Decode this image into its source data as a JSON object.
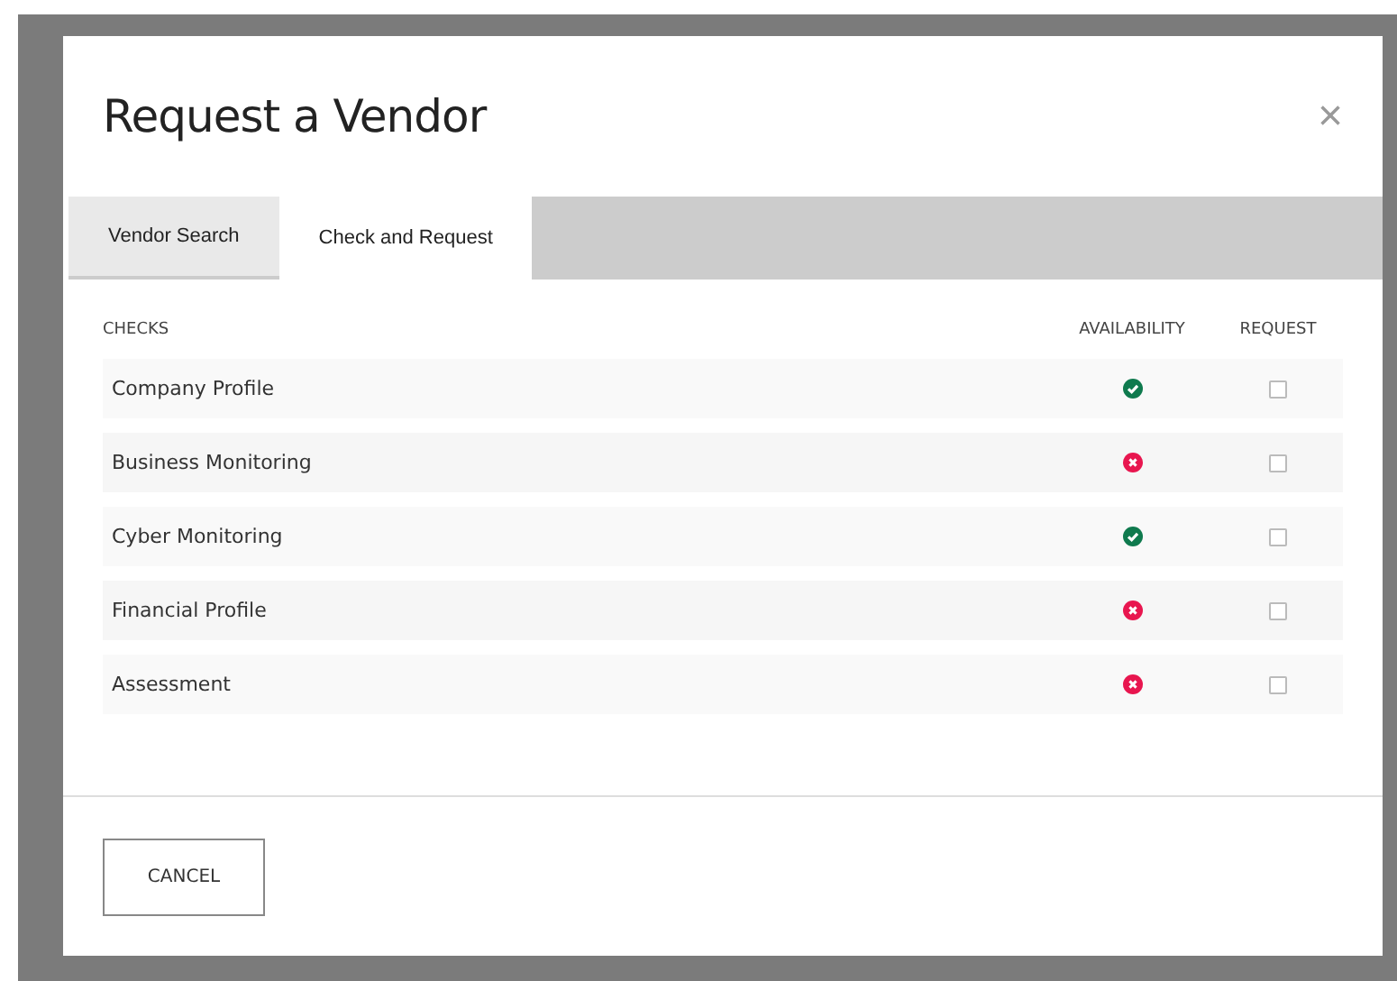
{
  "dialog": {
    "title": "Request a Vendor",
    "close": "×"
  },
  "tabs": [
    {
      "label": "Vendor Search",
      "selected": false
    },
    {
      "label": "Check and Request",
      "selected": true
    }
  ],
  "table": {
    "columns": [
      "CHECKS",
      "AVAILABILITY",
      "REQUEST"
    ],
    "rows": [
      {
        "name": "Company Profile",
        "available": true,
        "checked": false
      },
      {
        "name": "Business Monitoring",
        "available": false,
        "checked": false
      },
      {
        "name": "Cyber Monitoring",
        "available": true,
        "checked": false
      },
      {
        "name": "Financial Profile",
        "available": false,
        "checked": false
      },
      {
        "name": "Assessment",
        "available": false,
        "checked": false
      }
    ]
  },
  "buttons": [
    "CANCEL"
  ]
}
